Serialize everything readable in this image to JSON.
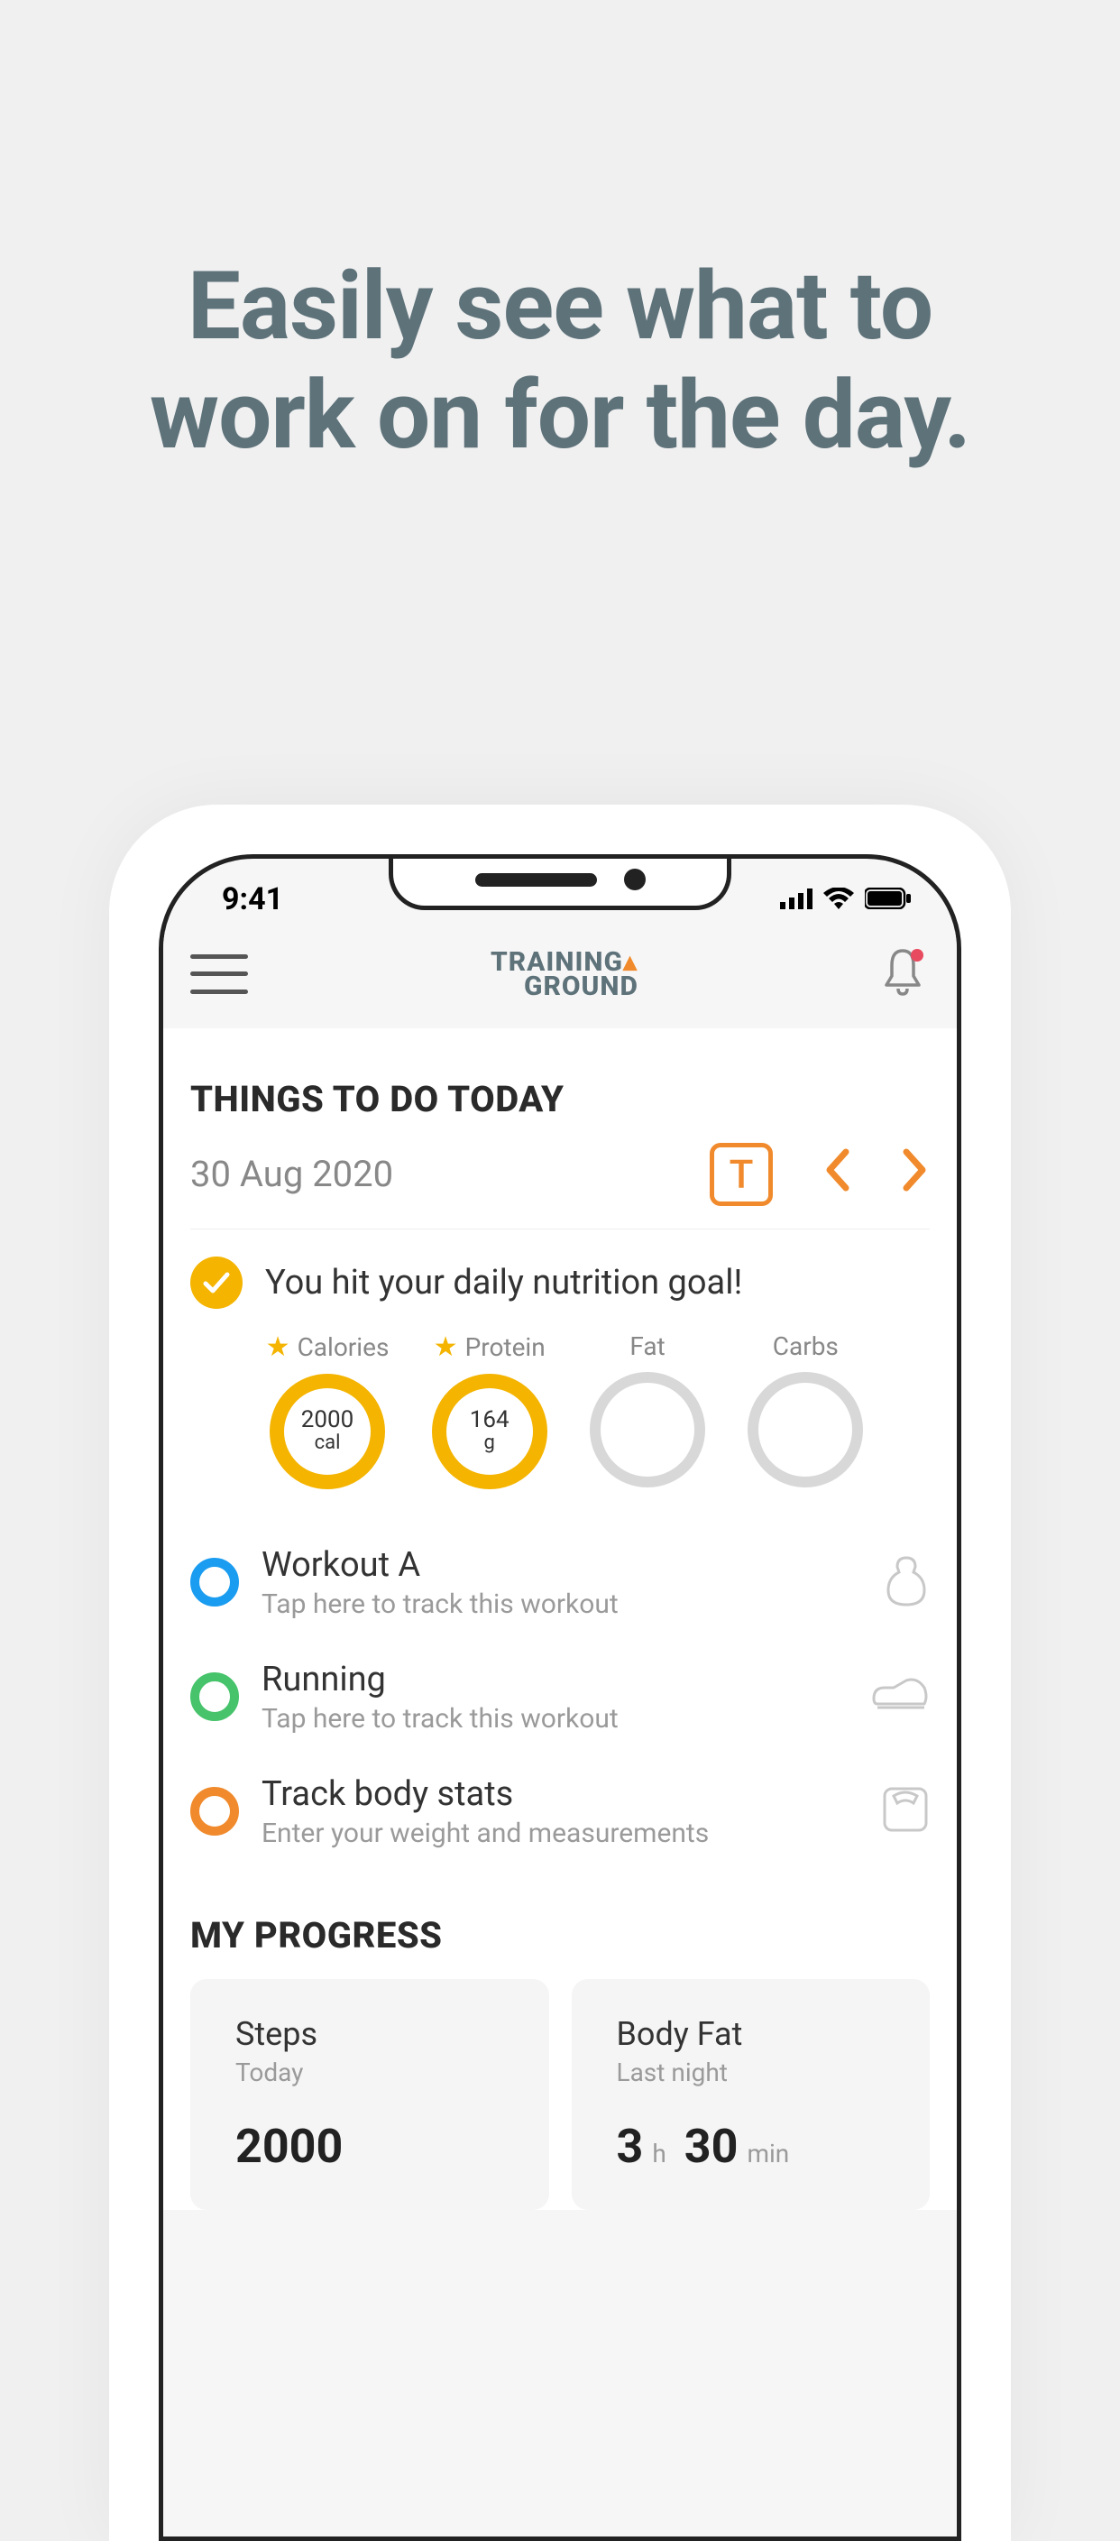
{
  "headline_line1": "Easily see what to",
  "headline_line2": "work on for the day.",
  "status": {
    "time": "9:41"
  },
  "logo": {
    "line1": "TRAINING",
    "line2": "GROUND"
  },
  "todo": {
    "title": "THINGS TO DO TODAY",
    "date": "30 Aug 2020",
    "today_label": "T"
  },
  "nutrition": {
    "goal_text": "You hit your daily nutrition goal!",
    "macros": [
      {
        "label": "Calories",
        "value": "2000",
        "unit": "cal",
        "starred": true,
        "filled": true
      },
      {
        "label": "Protein",
        "value": "164",
        "unit": "g",
        "starred": true,
        "filled": true
      },
      {
        "label": "Fat",
        "value": "",
        "unit": "",
        "starred": false,
        "filled": false
      },
      {
        "label": "Carbs",
        "value": "",
        "unit": "",
        "starred": false,
        "filled": false
      }
    ]
  },
  "tasks": [
    {
      "title": "Workout A",
      "subtitle": "Tap here to track this workout",
      "color": "blue",
      "icon": "kettlebell"
    },
    {
      "title": "Running",
      "subtitle": "Tap here to track this workout",
      "color": "green",
      "icon": "shoe"
    },
    {
      "title": "Track body stats",
      "subtitle": "Enter your weight and measurements",
      "color": "orange",
      "icon": "scale"
    }
  ],
  "progress": {
    "title": "MY PROGRESS",
    "cards": [
      {
        "title": "Steps",
        "subtitle": "Today",
        "value": "2000",
        "unit": ""
      },
      {
        "title": "Body Fat",
        "subtitle": "Last night",
        "value": "3",
        "unit": "h",
        "value2": "30",
        "unit2": "min"
      }
    ]
  }
}
